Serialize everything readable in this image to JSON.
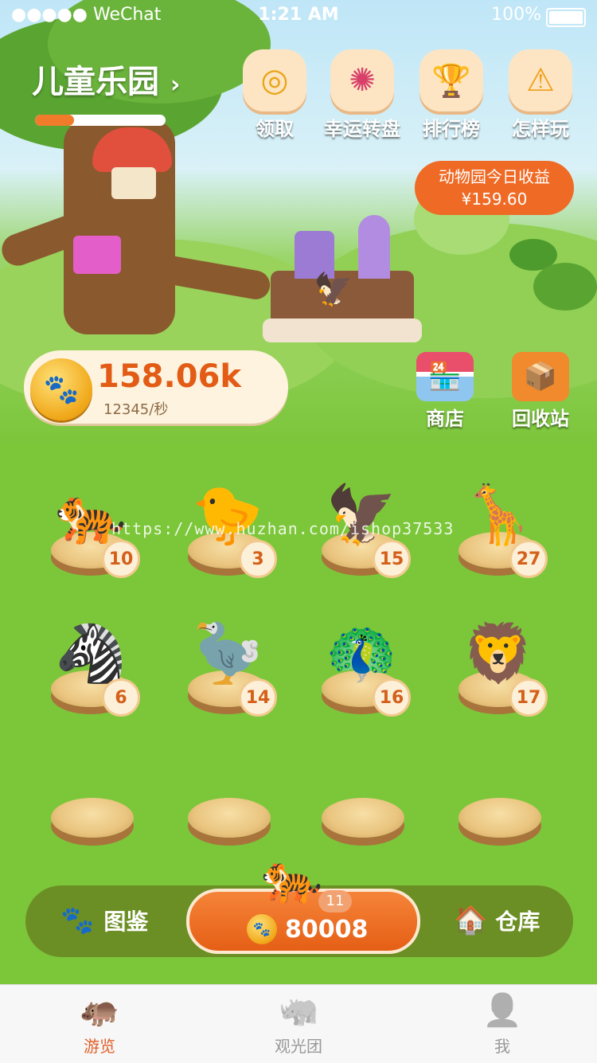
{
  "status_bar": {
    "carrier": "●●●●● WeChat",
    "time": "1:21 AM",
    "battery": "100%"
  },
  "header": {
    "title": "儿童乐园",
    "progress_percent": 30
  },
  "top_buttons": [
    {
      "label": "领取",
      "icon": "coins-icon"
    },
    {
      "label": "幸运转盘",
      "icon": "lucky-wheel-icon"
    },
    {
      "label": "排行榜",
      "icon": "trophy-icon"
    },
    {
      "label": "怎样玩",
      "icon": "help-warning-icon"
    }
  ],
  "zoo_earnings": {
    "label": "动物园今日收益",
    "amount": "¥159.60"
  },
  "coins": {
    "amount": "158.06k",
    "rate": "12345/秒"
  },
  "side_buttons": [
    {
      "label": "商店",
      "icon": "shop-icon"
    },
    {
      "label": "回收站",
      "icon": "recycle-box-icon"
    }
  ],
  "watermark": "https://www.huzhan.com/ishop37533",
  "animals": [
    {
      "name": "tiger",
      "level": "10",
      "glyph": "🐅"
    },
    {
      "name": "chick",
      "level": "3",
      "glyph": "🐤"
    },
    {
      "name": "eagle",
      "level": "15",
      "glyph": "🦅"
    },
    {
      "name": "giraffe",
      "level": "27",
      "glyph": "🦒"
    },
    {
      "name": "zebra",
      "level": "6",
      "glyph": "🦓"
    },
    {
      "name": "ostrich",
      "level": "14",
      "glyph": "🦤"
    },
    {
      "name": "peacock",
      "level": "16",
      "glyph": "🦚"
    },
    {
      "name": "lion",
      "level": "17",
      "glyph": "🦁"
    }
  ],
  "action_bar": {
    "pokedex_label": "图鉴",
    "store_label": "仓库",
    "buy_price": "80008",
    "buy_count": "11"
  },
  "tabs": [
    {
      "label": "游览",
      "active": true
    },
    {
      "label": "观光团",
      "active": false
    },
    {
      "label": "我",
      "active": false
    }
  ],
  "colors": {
    "accent": "#ef6a25",
    "grass": "#7cc63a",
    "active_tab": "#e0602a"
  }
}
